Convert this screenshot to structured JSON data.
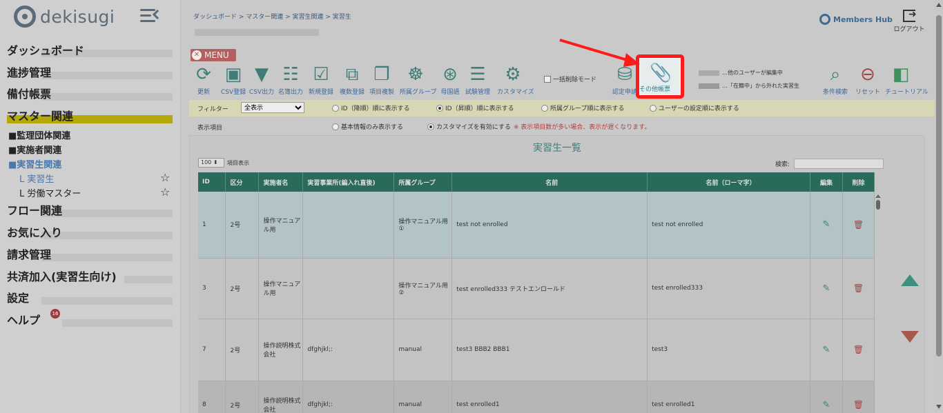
{
  "app": {
    "logo_text": "dekisugi"
  },
  "sidebar": {
    "items": [
      {
        "label": "ダッシュボード"
      },
      {
        "label": "進捗管理"
      },
      {
        "label": "備付帳票"
      },
      {
        "label": "マスター関連"
      },
      {
        "label": "フロー関連"
      },
      {
        "label": "お気に入り"
      },
      {
        "label": "請求管理"
      },
      {
        "label": "共済加入(実習生向け)"
      },
      {
        "label": "設定"
      },
      {
        "label": "ヘルプ"
      }
    ],
    "sub_items": [
      "■監理団体関連",
      "■実施者関連",
      "■実習生関連"
    ],
    "leaves": [
      "L 実習生",
      "L 労働マスター"
    ],
    "help_badge": "16"
  },
  "header": {
    "breadcrumb": "ダッシュボード > マスター関連 > 実習生関連 > 実習生",
    "members_hub": "Members Hub",
    "logout": "ログアウト",
    "menu": "MENU"
  },
  "toolbar": {
    "buttons": [
      {
        "label": "更新",
        "icon": "refresh-icon"
      },
      {
        "label": "CSV登録",
        "icon": "csv-register-icon"
      },
      {
        "label": "CSV出力",
        "icon": "csv-export-icon"
      },
      {
        "label": "名簿出力",
        "icon": "roster-icon"
      },
      {
        "label": "新規登録",
        "icon": "new-register-icon"
      },
      {
        "label": "複数登録",
        "icon": "multi-register-icon"
      },
      {
        "label": "項目複製",
        "icon": "copy-icon"
      },
      {
        "label": "所属グループ",
        "icon": "group-icon"
      },
      {
        "label": "母国語",
        "icon": "language-icon"
      },
      {
        "label": "試験管理",
        "icon": "exam-icon"
      },
      {
        "label": "カスタマイズ",
        "icon": "gear-icon"
      }
    ],
    "bulk_delete": "一括削除モード",
    "approval": "認定申請",
    "other_docs": "その他帳票",
    "legend_editing": "…他のユーザーが編集中",
    "legend_excluded": "…「在籍中」から外れた実習生",
    "condition_search": "条件検索",
    "reset": "リセット",
    "tutorial": "チュートリアル"
  },
  "filter": {
    "label": "フィルター",
    "select_value": "全表示",
    "options": [
      "ID（降順）順に表示する",
      "ID（昇順）順に表示する",
      "所属グループ順に表示する",
      "ユーザーの設定順に表示する"
    ]
  },
  "display": {
    "label": "表示項目",
    "basic": "基本情報のみ表示する",
    "custom": "カスタマイズを有効にする",
    "warning": "※ 表示項目数が多い場合、表示が遅くなります。"
  },
  "list": {
    "title": "実習生一覧",
    "page_length": "100",
    "page_length_suffix": "項目表示",
    "search_label": "検索:",
    "columns": [
      "ID",
      "区分",
      "実施者名",
      "実習事業所(編入れ直後)",
      "所属グループ",
      "名前",
      "名前（ローマ字）",
      "編集",
      "削除"
    ],
    "rows": [
      {
        "id": "1",
        "kubun": "2号",
        "company": "操作マニュアル用",
        "office": "",
        "group": "操作マニュアル用①",
        "name": "test not enrolled",
        "roman": "test not enrolled"
      },
      {
        "id": "3",
        "kubun": "2号",
        "company": "操作マニュアル用",
        "office": "",
        "group": "操作マニュアル用②",
        "name": "test enrolled333 テストエンロールド",
        "roman": "test enrolled333"
      },
      {
        "id": "7",
        "kubun": "2号",
        "company": "操作説明株式会社",
        "office": "dfghjkl;:",
        "group": "manual",
        "name": "test3 BBB2 BBB1",
        "roman": "test3"
      },
      {
        "id": "8",
        "kubun": "2号",
        "company": "操作説明株式会社",
        "office": "dfghjkl;:",
        "group": "manual",
        "name": "test enrolled1",
        "roman": "test enrolled1"
      }
    ]
  },
  "colors": {
    "accent": "#3f7e78",
    "highlight": "#ff1a1a",
    "header": "#296a5a"
  }
}
